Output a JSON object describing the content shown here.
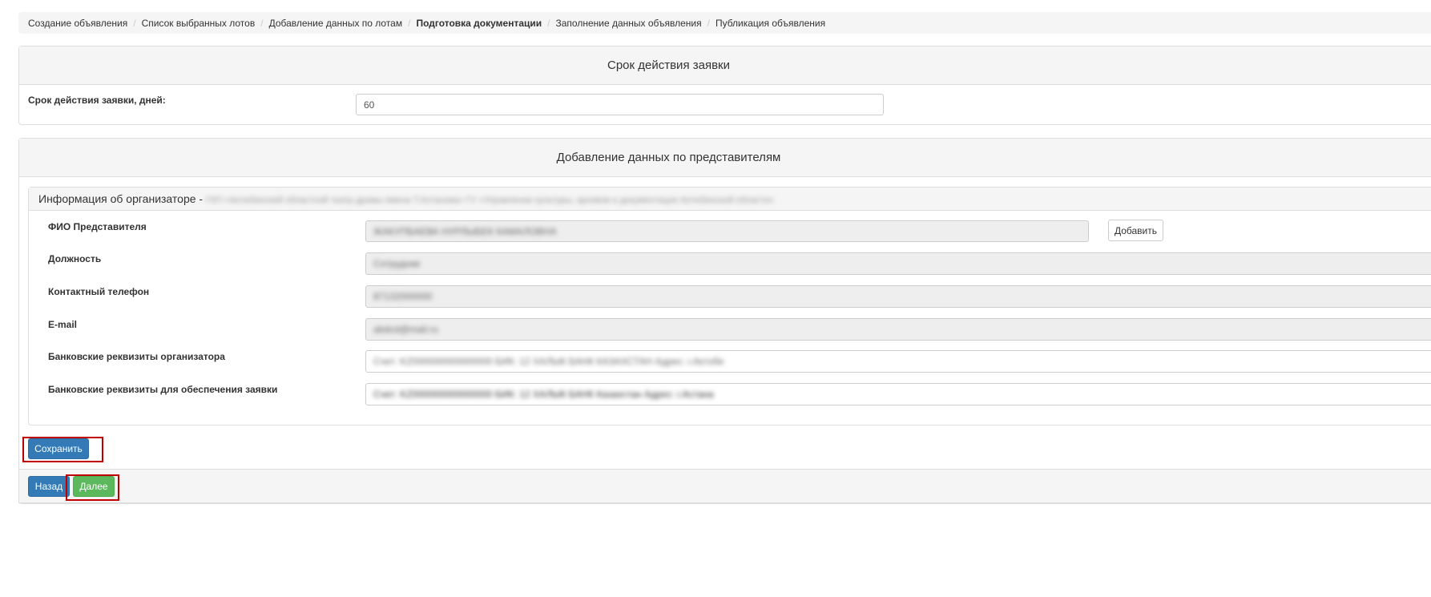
{
  "breadcrumb": {
    "items": [
      "Создание объявления",
      "Список выбранных лотов",
      "Добавление данных по лотам",
      "Подготовка документации",
      "Заполнение данных объявления",
      "Публикация объявления"
    ],
    "active_index": 3,
    "separator": "/"
  },
  "validity_panel": {
    "title": "Срок действия заявки",
    "field_label": "Срок действия заявки, дней:",
    "field_value": "60"
  },
  "representatives_panel": {
    "title": "Добавление данных по представителям",
    "organizer_heading": "Информация об организаторе -",
    "organizer_name_blurred": "ГКП «Актюбинский областной театр драмы имени Т.Ахтанова» ГУ «Управление культуры, архивов и документации Актюбинской области»",
    "fields": {
      "fio_label": "ФИО Представителя",
      "fio_value": "ЖАКУПБАЕВА НУРЛЫБЕК КАМАЛОВНА",
      "position_label": "Должность",
      "position_value": "Сотрудник",
      "phone_label": "Контактный телефон",
      "phone_value": "87132000000",
      "email_label": "E-mail",
      "email_value": "abdcd@mail.ru",
      "bank_label": "Банковские реквизиты организатора",
      "bank_value": "Счет: KZ000000000000000 БИК: 12 ХАЛЫК БАНК КАЗАХСТАН Адрес: г.Актобе",
      "bank_security_label": "Банковские реквизиты для обеспечения заявки",
      "bank_security_value": "Счет: KZ000000000000000 БИК: 12 ХАЛЫК БАНК Казахстан Адрес: г.Астана"
    },
    "add_button": "Добавить"
  },
  "actions": {
    "save": "Сохранить",
    "back": "Назад",
    "next": "Далее"
  },
  "colors": {
    "primary": "#337ab7",
    "success": "#5cb85c",
    "highlight": "#c00000"
  }
}
